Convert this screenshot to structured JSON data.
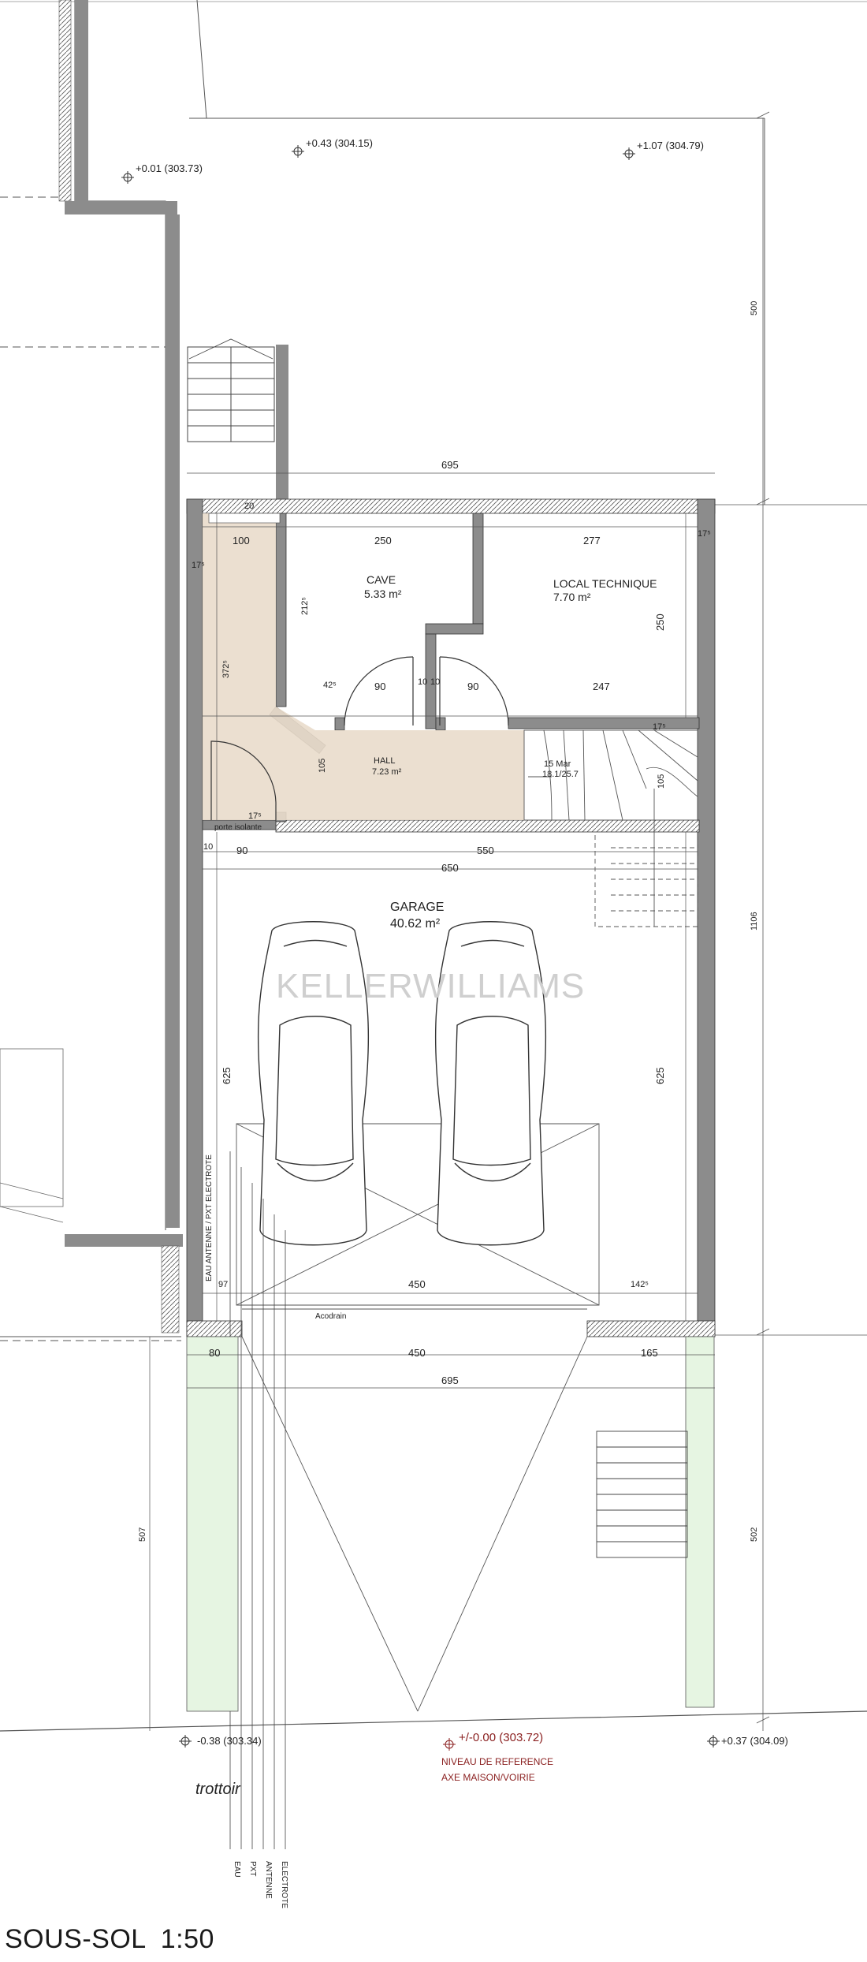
{
  "drawing": {
    "title": "SOUS-SOL",
    "scale": "1:50",
    "watermark": "KELLERWILLIAMS"
  },
  "rooms": {
    "cave": {
      "name": "CAVE",
      "area": "5.33 m²"
    },
    "local_technique": {
      "name": "LOCAL TECHNIQUE",
      "area": "7.70 m²"
    },
    "hall": {
      "name": "HALL",
      "area": "7.23 m²"
    },
    "garage": {
      "name": "GARAGE",
      "area": "40.62 m²"
    }
  },
  "levels": {
    "top_left": "+0.01 (303.73)",
    "top_mid": "+0.43 (304.15)",
    "top_right": "+1.07 (304.79)",
    "bottom_left": "-0.38 (303.34)",
    "bottom_right": "+0.37 (304.09)",
    "reference_value": "+/-0.00 (303.72)",
    "reference_line1": "NIVEAU DE REFERENCE",
    "reference_line2": "AXE MAISON/VOIRIE"
  },
  "dimensions": {
    "d500": "500",
    "d695_top": "695",
    "d20": "20",
    "d100": "100",
    "d250_h": "250",
    "d277": "277",
    "d17_5a": "17⁵",
    "d17_5b": "17⁵",
    "d21_2": "212⁵",
    "d37_2": "372⁵",
    "d42": "42⁵",
    "d90a": "90",
    "d10a": "10",
    "d10b": "10",
    "d90b": "90",
    "d247": "247",
    "d250_v": "250",
    "d105a": "105",
    "d105b": "105",
    "d17_5c": "17⁵",
    "d1106": "1106",
    "stairs": "15 Mar",
    "stairs2": "18.1/25.7",
    "d10c": "10",
    "d17_5d": "17⁵",
    "d90c": "90",
    "d550": "550",
    "d650": "650",
    "d625a": "625",
    "d625b": "625",
    "d97": "97",
    "d450a": "450",
    "d142": "142⁵",
    "d80": "80",
    "d450b": "450",
    "d165": "165",
    "d695_bot": "695",
    "d507": "507",
    "d502": "502"
  },
  "labels": {
    "porte": "porte isolante",
    "acodrain": "Acodrain",
    "trottoir": "trottoir",
    "services": "EAU   ANTENNE / PXT  ELECTROTE",
    "service_eau": "EAU",
    "service_pxt": "PXT",
    "service_antenne": "ANTENNE",
    "service_elec": "ELECTROTE"
  },
  "colors": {
    "wall": "#8c8c8c",
    "hall_fill": "#e9dccb",
    "garden_fill": "#e6f5e2",
    "red_mark": "#8a1f1f"
  }
}
